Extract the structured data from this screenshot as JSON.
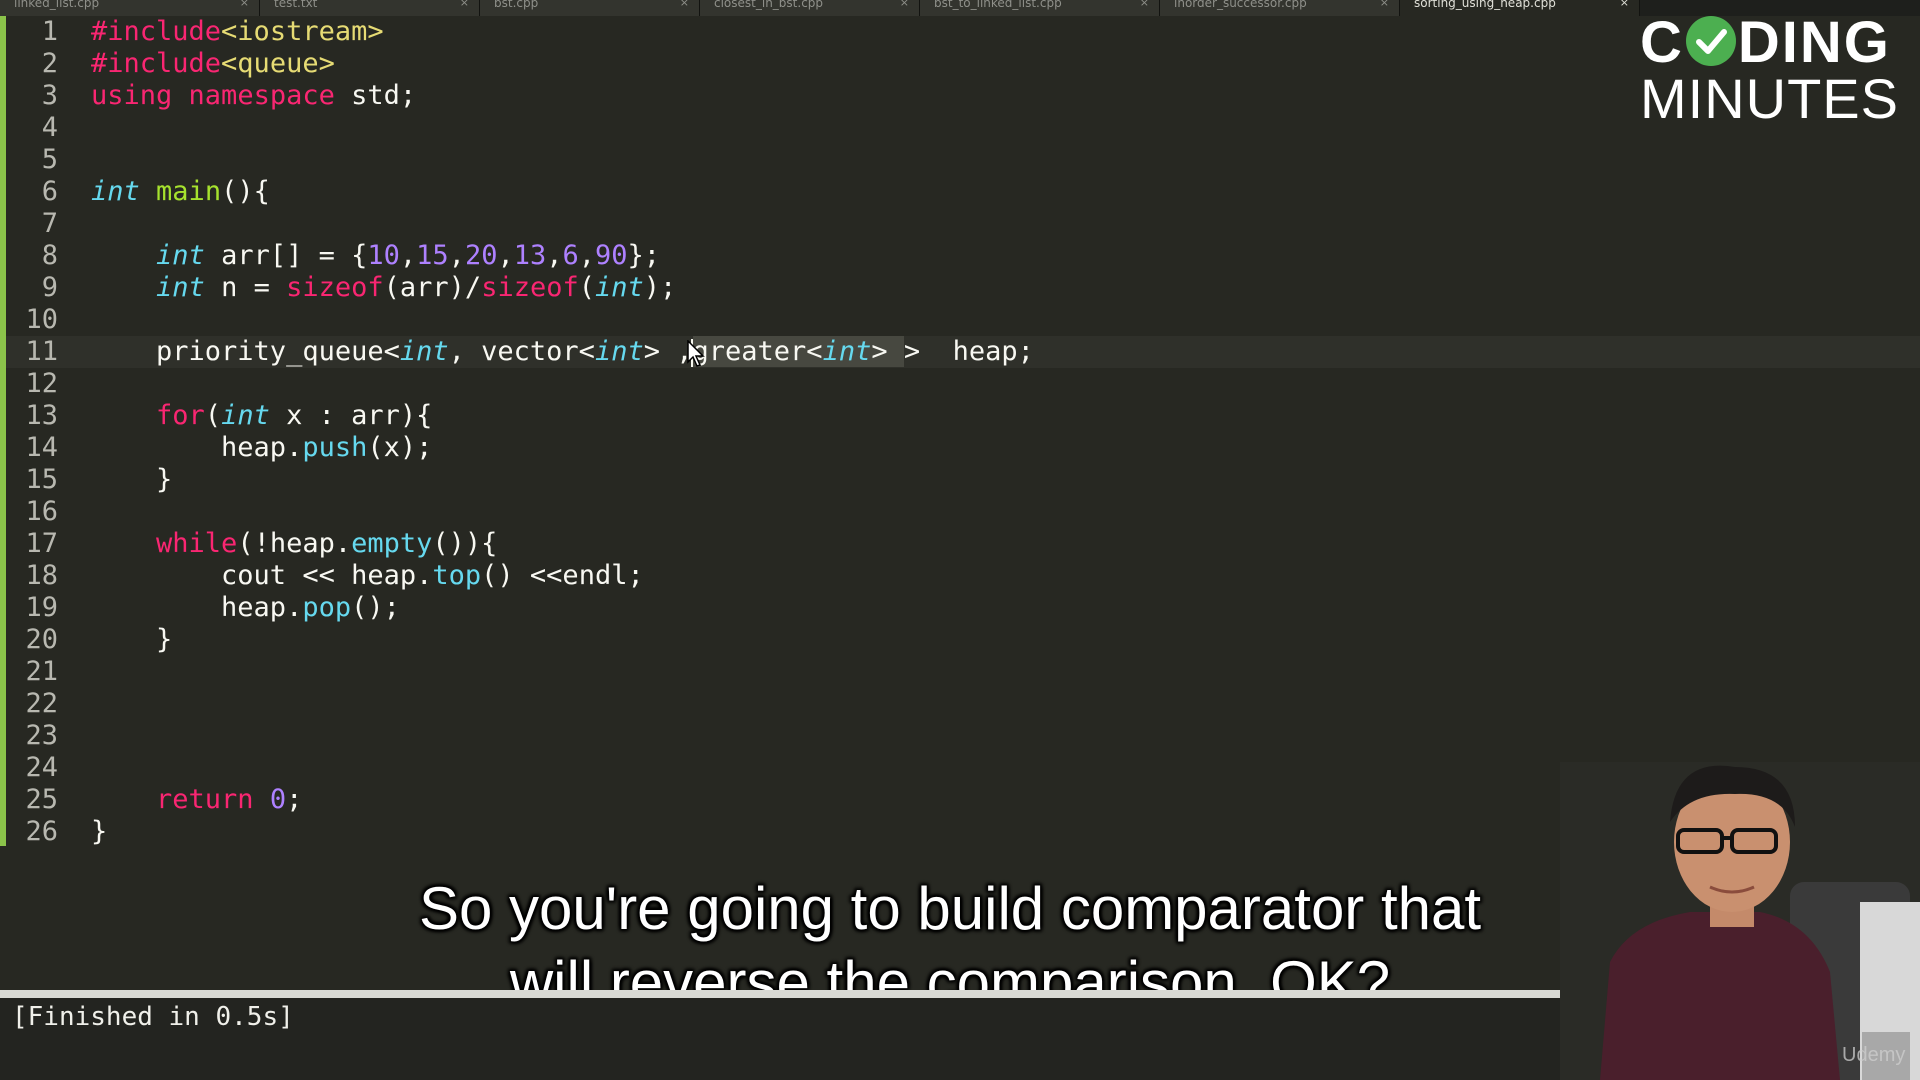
{
  "tabs": [
    {
      "label": "linked_list.cpp",
      "active": false
    },
    {
      "label": "test.txt",
      "active": false
    },
    {
      "label": "bst.cpp",
      "active": false
    },
    {
      "label": "closest_in_bst.cpp",
      "active": false
    },
    {
      "label": "bst_to_linked_list.cpp",
      "active": false
    },
    {
      "label": "inorder_successor.cpp",
      "active": false
    },
    {
      "label": "sorting_using_heap.cpp",
      "active": true
    }
  ],
  "editor": {
    "current_line": 11,
    "lines": [
      {
        "n": "1",
        "tokens": [
          {
            "t": "#include",
            "c": "kw"
          },
          {
            "t": "<iostream>",
            "c": "st"
          }
        ]
      },
      {
        "n": "2",
        "tokens": [
          {
            "t": "#include",
            "c": "kw"
          },
          {
            "t": "<queue>",
            "c": "st"
          }
        ]
      },
      {
        "n": "3",
        "tokens": [
          {
            "t": "using",
            "c": "kw"
          },
          {
            "t": " "
          },
          {
            "t": "namespace",
            "c": "kw"
          },
          {
            "t": " std;"
          }
        ]
      },
      {
        "n": "4",
        "tokens": []
      },
      {
        "n": "5",
        "tokens": []
      },
      {
        "n": "6",
        "tokens": [
          {
            "t": "int",
            "c": "ty"
          },
          {
            "t": " "
          },
          {
            "t": "main",
            "c": "fn"
          },
          {
            "t": "(){"
          }
        ]
      },
      {
        "n": "7",
        "tokens": []
      },
      {
        "n": "8",
        "tokens": [
          {
            "t": "    "
          },
          {
            "t": "int",
            "c": "ty"
          },
          {
            "t": " arr[] = {"
          },
          {
            "t": "10",
            "c": "num"
          },
          {
            "t": ","
          },
          {
            "t": "15",
            "c": "num"
          },
          {
            "t": ","
          },
          {
            "t": "20",
            "c": "num"
          },
          {
            "t": ","
          },
          {
            "t": "13",
            "c": "num"
          },
          {
            "t": ","
          },
          {
            "t": "6",
            "c": "num"
          },
          {
            "t": ","
          },
          {
            "t": "90",
            "c": "num"
          },
          {
            "t": "};"
          }
        ]
      },
      {
        "n": "9",
        "tokens": [
          {
            "t": "    "
          },
          {
            "t": "int",
            "c": "ty"
          },
          {
            "t": " n = "
          },
          {
            "t": "sizeof",
            "c": "kw"
          },
          {
            "t": "(arr)/"
          },
          {
            "t": "sizeof",
            "c": "kw"
          },
          {
            "t": "("
          },
          {
            "t": "int",
            "c": "ty"
          },
          {
            "t": ");"
          }
        ]
      },
      {
        "n": "10",
        "tokens": []
      },
      {
        "n": "11",
        "tokens": [
          {
            "t": "    priority_queue<"
          },
          {
            "t": "int",
            "c": "ty"
          },
          {
            "t": ", vector<"
          },
          {
            "t": "int",
            "c": "ty"
          },
          {
            "t": "> ,"
          },
          {
            "cursor": true
          },
          {
            "t": "greater<",
            "sel": true
          },
          {
            "t": "int",
            "c": "ty",
            "sel": true
          },
          {
            "t": "> ",
            "sel": true
          },
          {
            "t": "> "
          },
          {
            "t": " heap;"
          }
        ]
      },
      {
        "n": "12",
        "tokens": []
      },
      {
        "n": "13",
        "tokens": [
          {
            "t": "    "
          },
          {
            "t": "for",
            "c": "kw"
          },
          {
            "t": "("
          },
          {
            "t": "int",
            "c": "ty"
          },
          {
            "t": " x : arr){"
          }
        ]
      },
      {
        "n": "14",
        "tokens": [
          {
            "t": "        heap."
          },
          {
            "t": "push",
            "c": "cl"
          },
          {
            "t": "(x);"
          }
        ]
      },
      {
        "n": "15",
        "tokens": [
          {
            "t": "    }"
          }
        ]
      },
      {
        "n": "16",
        "tokens": []
      },
      {
        "n": "17",
        "tokens": [
          {
            "t": "    "
          },
          {
            "t": "while",
            "c": "kw"
          },
          {
            "t": "(!heap."
          },
          {
            "t": "empty",
            "c": "cl"
          },
          {
            "t": "()){"
          }
        ]
      },
      {
        "n": "18",
        "tokens": [
          {
            "t": "        cout << heap."
          },
          {
            "t": "top",
            "c": "cl"
          },
          {
            "t": "() <<endl;"
          }
        ]
      },
      {
        "n": "19",
        "tokens": [
          {
            "t": "        heap."
          },
          {
            "t": "pop",
            "c": "cl"
          },
          {
            "t": "();"
          }
        ]
      },
      {
        "n": "20",
        "tokens": [
          {
            "t": "    }"
          }
        ]
      },
      {
        "n": "21",
        "tokens": []
      },
      {
        "n": "22",
        "tokens": []
      },
      {
        "n": "23",
        "tokens": []
      },
      {
        "n": "24",
        "tokens": []
      },
      {
        "n": "25",
        "tokens": [
          {
            "t": "    "
          },
          {
            "t": "return",
            "c": "kw"
          },
          {
            "t": " "
          },
          {
            "t": "0",
            "c": "num"
          },
          {
            "t": ";"
          }
        ]
      },
      {
        "n": "26",
        "tokens": [
          {
            "t": "}"
          }
        ]
      }
    ]
  },
  "output": {
    "text": "[Finished in 0.5s]"
  },
  "subtitles": {
    "line1": "So you're going to build comparator that",
    "line2": "will reverse the comparison, OK?"
  },
  "logo": {
    "line1_before": "C",
    "line1_after": "DING",
    "line2": "MINUTES"
  },
  "watermark": "Udemy",
  "colors": {
    "background": "#272822",
    "keyword": "#f92672",
    "type": "#66d9ef",
    "function": "#a6e22e",
    "string": "#e6db74",
    "number": "#ae81ff",
    "gutter_marker": "#8bc34a",
    "logo_check": "#4caf50"
  }
}
